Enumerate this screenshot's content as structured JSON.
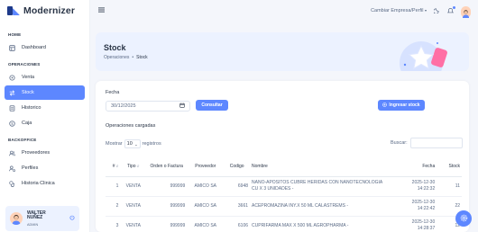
{
  "brand": {
    "name": "Modernizer"
  },
  "sidebar": {
    "sections": [
      {
        "label": "HOME",
        "items": [
          {
            "label": "Dashboard",
            "icon": "dashboard-icon"
          }
        ]
      },
      {
        "label": "OPERACIONES",
        "items": [
          {
            "label": "Venta",
            "icon": "cart-icon"
          },
          {
            "label": "Stock",
            "icon": "transfer-icon",
            "active": true
          },
          {
            "label": "Historico",
            "icon": "history-icon"
          },
          {
            "label": "Caja",
            "icon": "cash-icon"
          }
        ]
      },
      {
        "label": "BACKOFFICE",
        "items": [
          {
            "label": "Proveedores",
            "icon": "users-icon"
          },
          {
            "label": "Perfiles",
            "icon": "user-cog-icon"
          },
          {
            "label": "Historia Clinica",
            "icon": "medical-icon"
          }
        ]
      }
    ],
    "user": {
      "name_line1": "WALTER",
      "name_line2": "NUÑEZ",
      "role": "ADMIN"
    }
  },
  "topbar": {
    "company_label": "Cambiar Empresa/Perfil"
  },
  "hero": {
    "title": "Stock",
    "breadcrumb": [
      "Operaciones",
      "Stock"
    ]
  },
  "filters": {
    "date_label": "Fecha",
    "date_value": "30/12/2025",
    "consultar_label": "Consultar",
    "ingresar_label": "Ingresar stock"
  },
  "table_section": {
    "title": "Operaciones cargadas",
    "show_prefix": "Mostrar",
    "show_value": "10",
    "show_suffix": "registros",
    "search_label": "Buscar:"
  },
  "table": {
    "headers": [
      "#",
      "Tipo",
      "Orden o Factura",
      "Proveedor",
      "Codigo",
      "Nombre",
      "Fecha",
      "Stock"
    ],
    "rows": [
      {
        "num": "1",
        "tipo": "VENTA",
        "orden": "999999",
        "proveedor": "AMICO SA",
        "codigo": "6948",
        "nombre": "NANO-APOSITOS CUBRE HERIDAS CON NANOTECNOLOGIA CU X 3 UNIDADES -",
        "fecha_date": "2025-12-30",
        "fecha_time": "14:22:32",
        "stock": "11"
      },
      {
        "num": "2",
        "tipo": "VENTA",
        "orden": "999999",
        "proveedor": "AMICO SA",
        "codigo": "3661",
        "nombre": "ACEPROMAZINA INY.X 50 ML CALASTREMS -",
        "fecha_date": "2025-12-30",
        "fecha_time": "14:22:42",
        "stock": "22"
      },
      {
        "num": "3",
        "tipo": "VENTA",
        "orden": "999999",
        "proveedor": "AMICO SA",
        "codigo": "6106",
        "nombre": "CUPRIFARMA MAX X 500 ML AGROPHARMA -",
        "fecha_date": "2025-12-30",
        "fecha_time": "14:28:37",
        "stock": "12"
      }
    ]
  },
  "colors": {
    "primary": "#5d87ff",
    "hero_bg": "#ecf2ff",
    "text": "#2a3547"
  }
}
